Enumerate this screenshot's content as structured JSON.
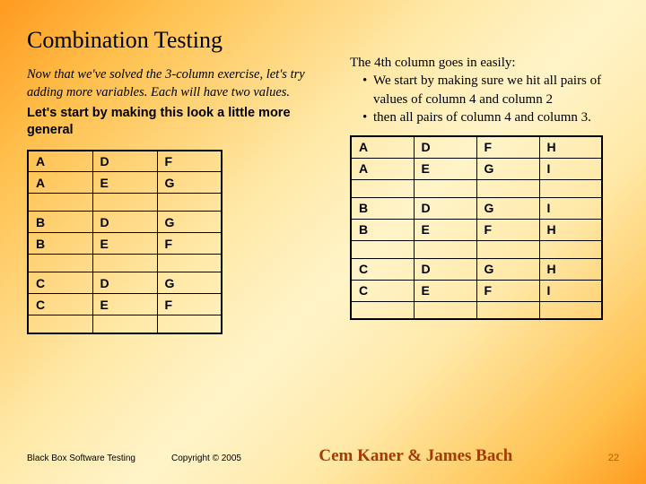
{
  "title": "Combination Testing",
  "left": {
    "intro_italic": "Now that we've solved the 3-column exercise, let's try adding more variables. Each will have two values.",
    "intro_bold": "Let's start by making this look a little more general",
    "table": [
      [
        "A",
        "D",
        "F"
      ],
      [
        "A",
        "E",
        "G"
      ],
      [
        "",
        "",
        ""
      ],
      [
        "B",
        "D",
        "G"
      ],
      [
        "B",
        "E",
        "F"
      ],
      [
        "",
        "",
        ""
      ],
      [
        "C",
        "D",
        "G"
      ],
      [
        "C",
        "E",
        "F"
      ],
      [
        "",
        "",
        ""
      ]
    ]
  },
  "right": {
    "intro_lead": "The 4th column goes in easily:",
    "bullets": [
      "We start by making sure we hit all pairs of values of column 4 and column 2",
      "then all pairs of column 4 and column 3."
    ],
    "table": [
      [
        "A",
        "D",
        "F",
        "H"
      ],
      [
        "A",
        "E",
        "G",
        "I"
      ],
      [
        "",
        "",
        "",
        ""
      ],
      [
        "B",
        "D",
        "G",
        "I"
      ],
      [
        "B",
        "E",
        "F",
        "H"
      ],
      [
        "",
        "",
        "",
        ""
      ],
      [
        "C",
        "D",
        "G",
        "H"
      ],
      [
        "C",
        "E",
        "F",
        "I"
      ],
      [
        "",
        "",
        "",
        ""
      ]
    ]
  },
  "footer": {
    "course": "Black Box Software Testing",
    "copyright": "Copyright © 2005",
    "authors": "Cem Kaner & James Bach",
    "page": "22"
  }
}
